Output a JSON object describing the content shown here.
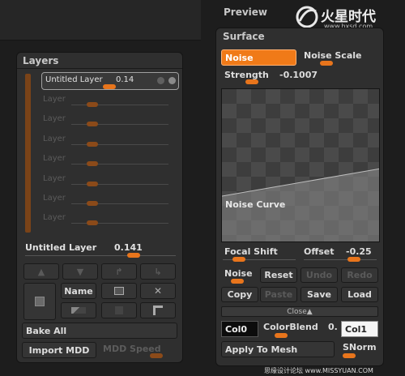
{
  "preview": {
    "title": "Preview"
  },
  "watermark": {
    "brand": "火星时代",
    "url": "www.hxsd.com",
    "bottom": "思缘设计论坛 www.MISSYUAN.COM"
  },
  "layers": {
    "title": "Layers",
    "active_layer": {
      "name": "Untitled Layer",
      "value": "0.14"
    },
    "empty_label": "Layer",
    "empty_rows": [
      "Layer",
      "Layer",
      "Layer",
      "Layer",
      "Layer",
      "Layer",
      "Layer"
    ],
    "slider": {
      "name": "Untitled Layer",
      "value": "0.141"
    },
    "name_button": "Name",
    "bake_all": "Bake All",
    "import_mdd": "Import MDD",
    "mdd_speed": "MDD Speed"
  },
  "surface": {
    "title": "Surface",
    "noise_button": "Noise",
    "noise_scale": "Noise Scale",
    "strength": {
      "label": "Strength",
      "value": "-0.1007"
    },
    "noise_curve_label": "Noise Curve",
    "focal_shift": "Focal Shift",
    "offset": {
      "label": "Offset",
      "value": "-0.25"
    },
    "noise_label": "Noise",
    "reset": "Reset",
    "undo": "Undo",
    "redo": "Redo",
    "copy": "Copy",
    "paste": "Paste",
    "save": "Save",
    "load": "Load",
    "close": "Close",
    "col0": "Col0",
    "color_blend": {
      "label": "ColorBlend",
      "value": "0."
    },
    "col1": "Col1",
    "apply_to_mesh": "Apply To Mesh",
    "snorm": "SNorm"
  },
  "colors": {
    "accent": "#f07a18",
    "panel": "#2f2f2f",
    "bg": "#1d1d1d"
  }
}
